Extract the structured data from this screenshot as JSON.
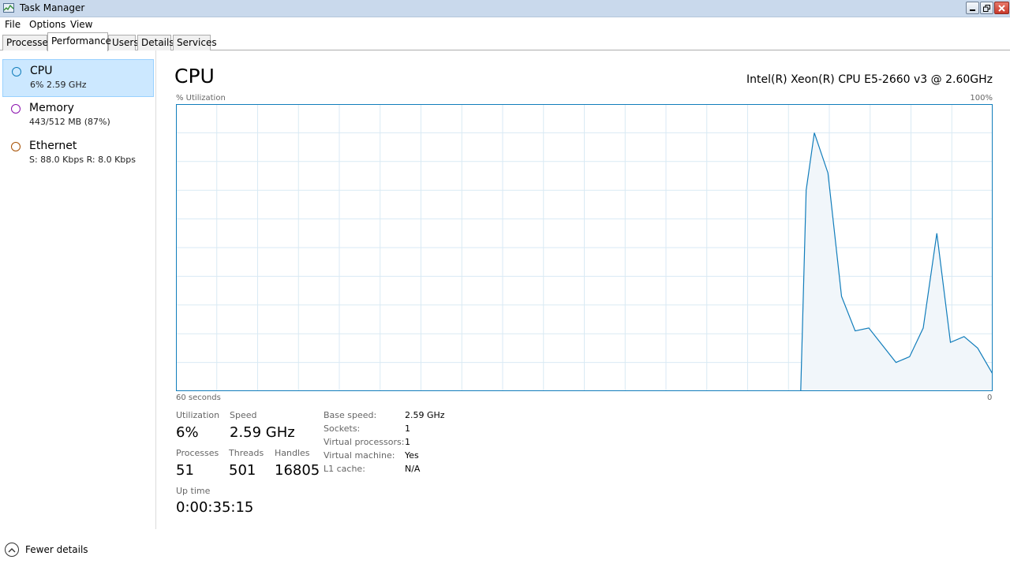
{
  "window": {
    "title": "Task Manager"
  },
  "menu": [
    "File",
    "Options",
    "View"
  ],
  "tabs": [
    "Processes",
    "Performance",
    "Users",
    "Details",
    "Services"
  ],
  "active_tab": "Performance",
  "sidebar": {
    "items": [
      {
        "title": "CPU",
        "subtitle": "6% 2.59 GHz",
        "color": "#117dbb"
      },
      {
        "title": "Memory",
        "subtitle": "443/512 MB (87%)",
        "color": "#8b12ae"
      },
      {
        "title": "Ethernet",
        "subtitle": "S: 88.0 Kbps R: 8.0 Kbps",
        "color": "#a74f01"
      }
    ]
  },
  "main": {
    "title": "CPU",
    "cpu_model": "Intel(R) Xeon(R) CPU E5-2660 v3 @ 2.60GHz",
    "graph_label": "% Utilization",
    "graph_max": "100%",
    "graph_time": "60 seconds",
    "graph_min": "0"
  },
  "stats": {
    "utilization_label": "Utilization",
    "utilization": "6%",
    "speed_label": "Speed",
    "speed": "2.59 GHz",
    "processes_label": "Processes",
    "processes": "51",
    "threads_label": "Threads",
    "threads": "501",
    "handles_label": "Handles",
    "handles": "16805",
    "uptime_label": "Up time",
    "uptime": "0:00:35:15"
  },
  "info": {
    "base_speed_label": "Base speed:",
    "base_speed": "2.59 GHz",
    "sockets_label": "Sockets:",
    "sockets": "1",
    "virtual_processors_label": "Virtual processors:",
    "virtual_processors": "1",
    "virtual_machine_label": "Virtual machine:",
    "virtual_machine": "Yes",
    "l1_cache_label": "L1 cache:",
    "l1_cache": "N/A"
  },
  "footer": {
    "fewer_details": "Fewer details"
  },
  "chart_data": {
    "type": "area",
    "xlim": [
      60,
      0
    ],
    "ylim": [
      0,
      100
    ],
    "grid": true,
    "line_color": "#117dbb",
    "fill_color": "#f1f6fa",
    "points": [
      [
        14.6,
        0
      ],
      [
        14.1,
        0
      ],
      [
        13.7,
        70
      ],
      [
        13.1,
        90
      ],
      [
        12.1,
        76
      ],
      [
        11.1,
        33
      ],
      [
        10.1,
        21
      ],
      [
        9.1,
        22
      ],
      [
        8.1,
        16
      ],
      [
        7.1,
        10
      ],
      [
        6.1,
        12
      ],
      [
        5.1,
        22
      ],
      [
        4.1,
        55
      ],
      [
        3.1,
        17
      ],
      [
        2.1,
        19
      ],
      [
        1.1,
        15
      ],
      [
        0,
        6
      ]
    ]
  }
}
